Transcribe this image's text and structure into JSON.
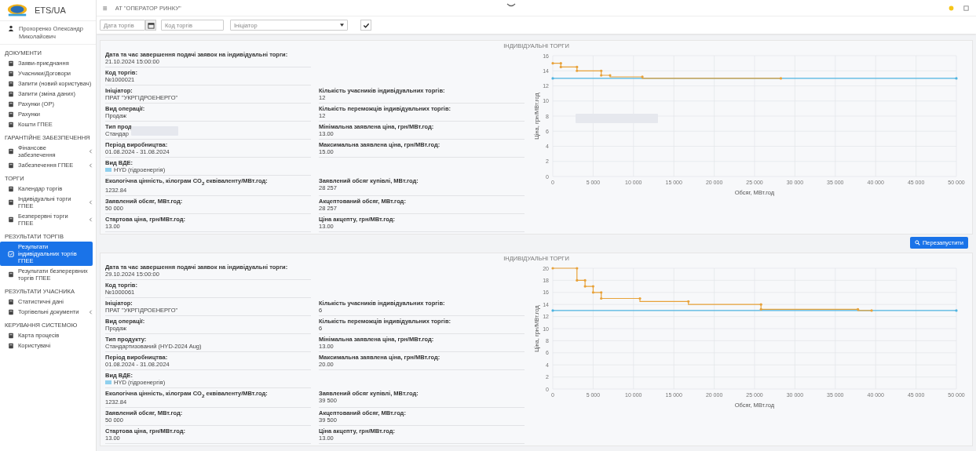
{
  "logo": {
    "text": "ETS/UA"
  },
  "user": {
    "name": "Прохоренко Олександр Миколайович"
  },
  "sidebar": {
    "sections": [
      {
        "title": "ДОКУМЕНТИ",
        "items": [
          {
            "label": "Заяви-приєднання",
            "selected": false,
            "has_submenu": false
          },
          {
            "label": "Учасники/Договори",
            "selected": false,
            "has_submenu": false
          },
          {
            "label": "Запити (новий користувач)",
            "selected": false,
            "has_submenu": false
          },
          {
            "label": "Запити (зміна даних)",
            "selected": false,
            "has_submenu": false
          },
          {
            "label": "Рахунки (ОР)",
            "selected": false,
            "has_submenu": false
          },
          {
            "label": "Рахунки",
            "selected": false,
            "has_submenu": false
          },
          {
            "label": "Кошти ГПЕЕ",
            "selected": false,
            "has_submenu": false
          }
        ]
      },
      {
        "title": "ГАРАНТІЙНЕ ЗАБЕЗПЕЧЕННЯ",
        "items": [
          {
            "label": "Фінансове забезпечення",
            "selected": false,
            "has_submenu": true
          },
          {
            "label": "Забезпечення ГПЕЕ",
            "selected": false,
            "has_submenu": true
          }
        ]
      },
      {
        "title": "ТОРГИ",
        "items": [
          {
            "label": "Календар торгів",
            "selected": false,
            "has_submenu": false
          },
          {
            "label": "Індивідуальні торги ГПЕЕ",
            "selected": false,
            "has_submenu": true
          },
          {
            "label": "Безперервні торги ГПЕЕ",
            "selected": false,
            "has_submenu": true
          }
        ]
      },
      {
        "title": "РЕЗУЛЬТАТИ ТОРГІВ",
        "items": [
          {
            "label": "Результати індивідуальних торгів ГПЕЕ",
            "selected": true,
            "has_submenu": false
          },
          {
            "label": "Результати безперервних торгів ГПЕЕ",
            "selected": false,
            "has_submenu": false
          }
        ]
      },
      {
        "title": "РЕЗУЛЬТАТИ УЧАСНИКА",
        "items": [
          {
            "label": "Статистичні дані",
            "selected": false,
            "has_submenu": false
          },
          {
            "label": "Торгівельні документи",
            "selected": false,
            "has_submenu": true
          }
        ]
      },
      {
        "title": "КЕРУВАННЯ СИСТЕМОЮ",
        "items": [
          {
            "label": "Карта процесів",
            "selected": false,
            "has_submenu": false
          },
          {
            "label": "Користувачі",
            "selected": false,
            "has_submenu": false
          }
        ]
      }
    ]
  },
  "topbar": {
    "menu_glyph": "≡",
    "organization": "АТ \"ОПЕРАТОР РИНКУ\""
  },
  "filters": {
    "date_placeholder": "Дата торгів",
    "code_placeholder": "Код торгів",
    "initiator_placeholder": "Ініціатор"
  },
  "auctions": [
    {
      "title": "ІНДИВІДУАЛЬНІ ТОРГИ",
      "chart_redacted": true,
      "restart_button": "Перезапустити",
      "rows": [
        {
          "left": {
            "label": "Дата та час завершення подачі заявок на індивідуальні торги:",
            "value": "21.10.2024 15:00:00"
          }
        },
        {
          "left": {
            "label": "Код торгів:",
            "value": "№1000021"
          }
        },
        {
          "left": {
            "label": "Ініціатор:",
            "value": "ПРАТ \"УКРГІДРОЕНЕРГО\""
          },
          "right": {
            "label": "Кількість учасників індивідуальних торгів:",
            "value": "12"
          }
        },
        {
          "left": {
            "label": "Вид операції:",
            "value": "Продаж"
          },
          "right": {
            "label": "Кількість переможців індивідуальних торгів:",
            "value": "12"
          }
        },
        {
          "left": {
            "label": "Тип прод",
            "value": "Стандар",
            "redacted": true
          },
          "right": {
            "label": "Мінімальна заявлена ціна, грн/МВт.год:",
            "value": "13.00"
          }
        },
        {
          "left": {
            "label": "Період виробництва:",
            "value": "01.08.2024 - 31.08.2024"
          },
          "right": {
            "label": "Максимальна заявлена ціна, грн/МВт.год:",
            "value": "15.00"
          }
        },
        {
          "left": {
            "label": "Вид ВДЕ:",
            "value": "HYD (гідроенергія)",
            "color": "#8fd0ee"
          }
        },
        {
          "left": {
            "label": "Екологічна цінність, кілограм CO$_{2}$ еквіваленту/МВт.год:",
            "value": "1232.84"
          },
          "right": {
            "label": "Заявлений обсяг купівлі, МВт.год:",
            "value": "28 257"
          }
        },
        {
          "left": {
            "label": "Заявлений обсяг, МВт.год:",
            "value": "50 000"
          },
          "right": {
            "label": "Акцептований обсяг, МВт.год:",
            "value": "28 257"
          }
        },
        {
          "left": {
            "label": "Стартова ціна, грн/МВт.год:",
            "value": "13.00"
          },
          "right": {
            "label": "Ціна акцепту, грн/МВт.год:",
            "value": "13.00"
          }
        }
      ],
      "chart_data": {
        "type": "line",
        "grid": true,
        "xlabel": "Обсяг, МВт.год",
        "ylabel": "Ціна, грн/МВт.год",
        "xlim": [
          0,
          50000
        ],
        "ylim": [
          0,
          16
        ],
        "yticks": [
          0,
          2,
          4,
          6,
          8,
          10,
          12,
          14,
          16
        ],
        "xticks": [
          {
            "value": 0,
            "label": "0"
          },
          {
            "value": 5000,
            "label": "5 000"
          },
          {
            "value": 10000,
            "label": "10 000"
          },
          {
            "value": 15000,
            "label": "15 000"
          },
          {
            "value": 20000,
            "label": "20 000"
          },
          {
            "value": 25000,
            "label": "25 000"
          },
          {
            "value": 30000,
            "label": "30 000"
          },
          {
            "value": 35000,
            "label": "35 000"
          },
          {
            "value": 40000,
            "label": "40 000"
          },
          {
            "value": 45000,
            "label": "45 000"
          },
          {
            "value": 50000,
            "label": "50 000"
          }
        ],
        "series": [
          {
            "color": "#e8a23a",
            "x": [
              0,
              1000,
              1000,
              3000,
              3000,
              6000,
              6000,
              7100,
              7100,
              11100,
              11100,
              28257
            ],
            "values": [
              15,
              15,
              14.5,
              14.5,
              14,
              14,
              13.4,
              13.4,
              13.2,
              13.2,
              13,
              13
            ]
          },
          {
            "color": "#4db3e0",
            "x": [
              0,
              50000
            ],
            "values": [
              13,
              13
            ]
          }
        ]
      }
    },
    {
      "title": "ІНДИВІДУАЛЬНІ ТОРГИ",
      "chart_redacted": false,
      "rows": [
        {
          "left": {
            "label": "Дата та час завершення подачі заявок на індивідуальні торги:",
            "value": "29.10.2024 15:00:00"
          }
        },
        {
          "left": {
            "label": "Код торгів:",
            "value": "№1000061"
          }
        },
        {
          "left": {
            "label": "Ініціатор:",
            "value": "ПРАТ \"УКРГІДРОЕНЕРГО\""
          },
          "right": {
            "label": "Кількість учасників індивідуальних торгів:",
            "value": "6"
          }
        },
        {
          "left": {
            "label": "Вид операції:",
            "value": "Продаж"
          },
          "right": {
            "label": "Кількість переможців індивідуальних торгів:",
            "value": "6"
          }
        },
        {
          "left": {
            "label": "Тип продукту:",
            "value": "Стандартизований (HYD-2024 Aug)"
          },
          "right": {
            "label": "Мінімальна заявлена ціна, грн/МВт.год:",
            "value": "13.00"
          }
        },
        {
          "left": {
            "label": "Період виробництва:",
            "value": "01.08.2024 - 31.08.2024"
          },
          "right": {
            "label": "Максимальна заявлена ціна, грн/МВт.год:",
            "value": "20.00"
          }
        },
        {
          "left": {
            "label": "Вид ВДЕ:",
            "value": "HYD (гідроенергія)",
            "color": "#8fd0ee"
          }
        },
        {
          "left": {
            "label": "Екологічна цінність, кілограм CO$_{2}$ еквіваленту/МВт.год:",
            "value": "1232.84"
          },
          "right": {
            "label": "Заявлений обсяг купівлі, МВт.год:",
            "value": "39 500"
          }
        },
        {
          "left": {
            "label": "Заявлений обсяг, МВт.год:",
            "value": "50 000"
          },
          "right": {
            "label": "Акцептований обсяг, МВт.год:",
            "value": "39 500"
          }
        },
        {
          "left": {
            "label": "Стартова ціна, грн/МВт.год:",
            "value": "13.00"
          },
          "right": {
            "label": "Ціна акцепту, грн/МВт.год:",
            "value": "13.00"
          }
        }
      ],
      "chart_data": {
        "type": "line",
        "grid": true,
        "xlabel": "Обсяг, МВт.год",
        "ylabel": "Ціна, грн/МВт.год",
        "xlim": [
          0,
          50000
        ],
        "ylim": [
          0,
          20
        ],
        "yticks": [
          0,
          2,
          4,
          6,
          8,
          10,
          12,
          14,
          16,
          18,
          20
        ],
        "xticks": [
          {
            "value": 0,
            "label": "0"
          },
          {
            "value": 5000,
            "label": "5 000"
          },
          {
            "value": 10000,
            "label": "10 000"
          },
          {
            "value": 15000,
            "label": "15 000"
          },
          {
            "value": 20000,
            "label": "20 000"
          },
          {
            "value": 25000,
            "label": "25 000"
          },
          {
            "value": 30000,
            "label": "30 000"
          },
          {
            "value": 35000,
            "label": "35 000"
          },
          {
            "value": 40000,
            "label": "40 000"
          },
          {
            "value": 45000,
            "label": "45 000"
          },
          {
            "value": 50000,
            "label": "50 000"
          }
        ],
        "series": [
          {
            "color": "#e8a23a",
            "x": [
              0,
              3000,
              3000,
              4000,
              4000,
              5000,
              5000,
              6000,
              6000,
              10800,
              10800,
              16800,
              16800,
              25800,
              25800,
              37800,
              37800,
              39500
            ],
            "values": [
              20,
              20,
              18,
              18,
              17,
              17,
              16,
              16,
              15,
              15,
              14.5,
              14.5,
              14,
              14,
              13.2,
              13.2,
              13,
              13
            ]
          },
          {
            "color": "#4db3e0",
            "x": [
              0,
              50000
            ],
            "values": [
              13,
              13
            ]
          }
        ]
      }
    }
  ]
}
